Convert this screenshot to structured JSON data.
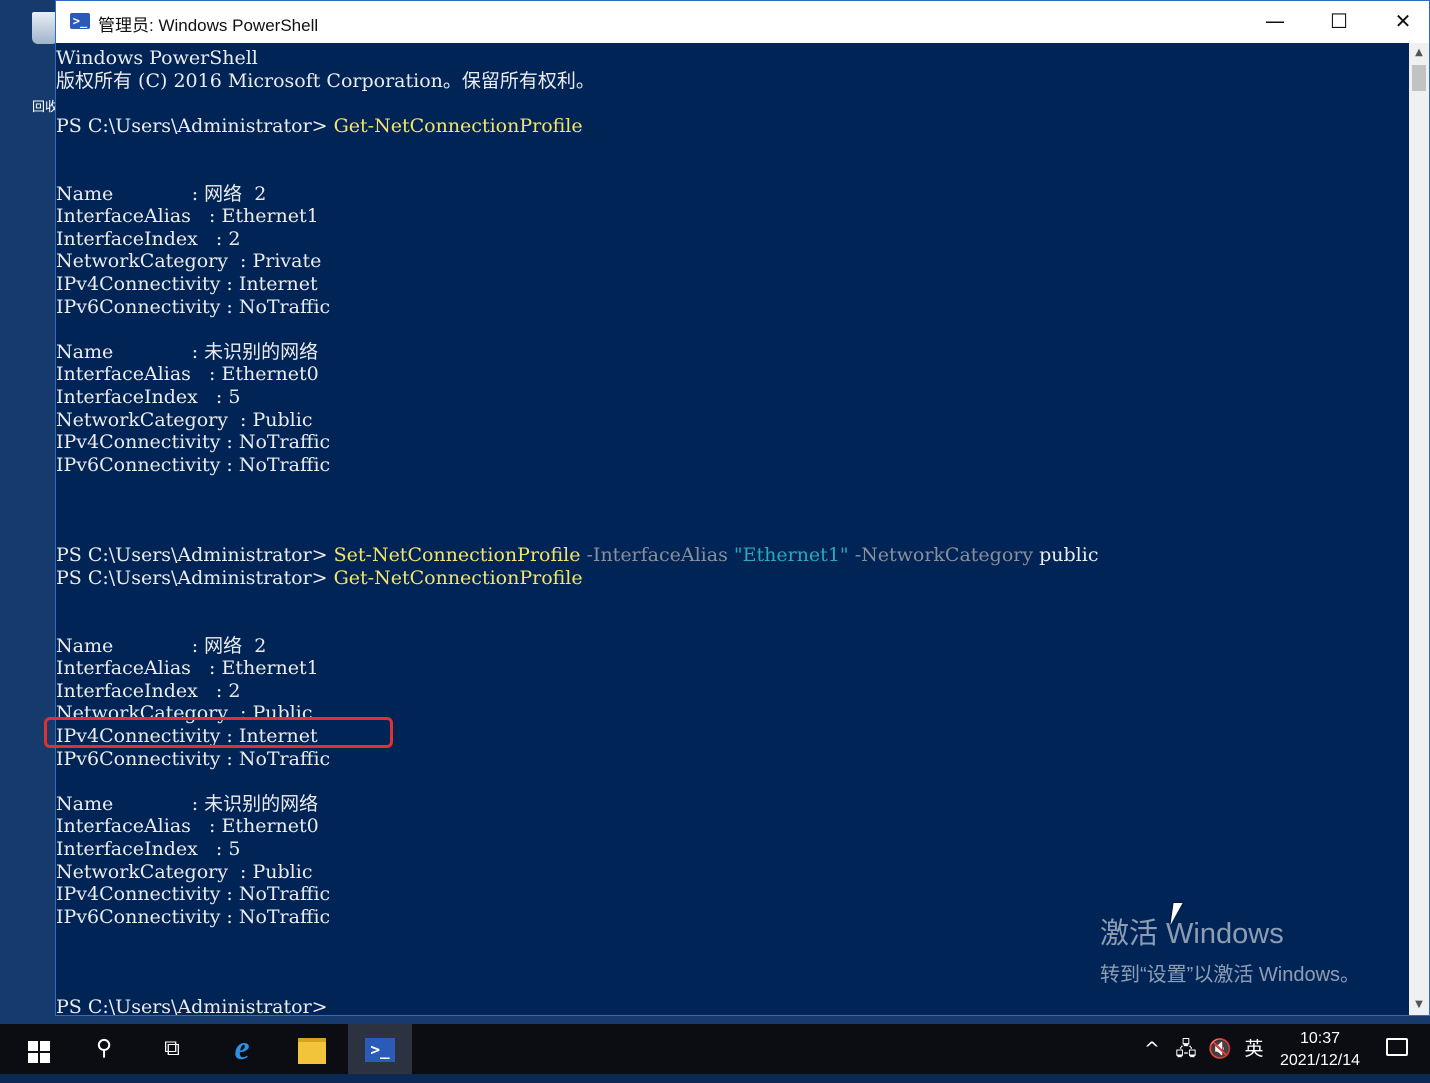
{
  "desktop": {
    "recycle_bin_label": "回收"
  },
  "window": {
    "title": "管理员: Windows PowerShell",
    "buttons": {
      "minimize": "—",
      "maximize": "☐",
      "close": "✕"
    }
  },
  "console": {
    "lines": [
      {
        "segs": [
          {
            "t": "Windows PowerShell",
            "c": "val"
          }
        ]
      },
      {
        "segs": [
          {
            "t": "版权所有 (C) 2016 Microsoft Corporation。保留所有权利。",
            "c": "val"
          }
        ]
      },
      {
        "segs": [
          {
            "t": "",
            "c": "val"
          }
        ]
      },
      {
        "segs": [
          {
            "t": "PS C:\\Users\\Administrator> ",
            "c": "val"
          },
          {
            "t": "Get-NetConnectionProfile",
            "c": "cmd"
          }
        ]
      },
      {
        "segs": [
          {
            "t": "",
            "c": "val"
          }
        ]
      },
      {
        "segs": [
          {
            "t": "",
            "c": "val"
          }
        ]
      },
      {
        "segs": [
          {
            "t": "Name             : 网络  2",
            "c": "val"
          }
        ]
      },
      {
        "segs": [
          {
            "t": "InterfaceAlias   : Ethernet1",
            "c": "val"
          }
        ]
      },
      {
        "segs": [
          {
            "t": "InterfaceIndex   : 2",
            "c": "val"
          }
        ]
      },
      {
        "segs": [
          {
            "t": "NetworkCategory  : Private",
            "c": "val"
          }
        ]
      },
      {
        "segs": [
          {
            "t": "IPv4Connectivity : Internet",
            "c": "val"
          }
        ]
      },
      {
        "segs": [
          {
            "t": "IPv6Connectivity : NoTraffic",
            "c": "val"
          }
        ]
      },
      {
        "segs": [
          {
            "t": "",
            "c": "val"
          }
        ]
      },
      {
        "segs": [
          {
            "t": "Name             : 未识别的网络",
            "c": "val"
          }
        ]
      },
      {
        "segs": [
          {
            "t": "InterfaceAlias   : Ethernet0",
            "c": "val"
          }
        ]
      },
      {
        "segs": [
          {
            "t": "InterfaceIndex   : 5",
            "c": "val"
          }
        ]
      },
      {
        "segs": [
          {
            "t": "NetworkCategory  : Public",
            "c": "val"
          }
        ]
      },
      {
        "segs": [
          {
            "t": "IPv4Connectivity : NoTraffic",
            "c": "val"
          }
        ]
      },
      {
        "segs": [
          {
            "t": "IPv6Connectivity : NoTraffic",
            "c": "val"
          }
        ]
      },
      {
        "segs": [
          {
            "t": "",
            "c": "val"
          }
        ]
      },
      {
        "segs": [
          {
            "t": "",
            "c": "val"
          }
        ]
      },
      {
        "segs": [
          {
            "t": "",
            "c": "val"
          }
        ]
      },
      {
        "segs": [
          {
            "t": "PS C:\\Users\\Administrator> ",
            "c": "val"
          },
          {
            "t": "Set-NetConnectionProfile ",
            "c": "cmd"
          },
          {
            "t": "-InterfaceAlias ",
            "c": "param"
          },
          {
            "t": "\"Ethernet1\" ",
            "c": "str"
          },
          {
            "t": "-NetworkCategory ",
            "c": "param"
          },
          {
            "t": "public",
            "c": "val"
          }
        ]
      },
      {
        "segs": [
          {
            "t": "PS C:\\Users\\Administrator> ",
            "c": "val"
          },
          {
            "t": "Get-NetConnectionProfile",
            "c": "cmd"
          }
        ]
      },
      {
        "segs": [
          {
            "t": "",
            "c": "val"
          }
        ]
      },
      {
        "segs": [
          {
            "t": "",
            "c": "val"
          }
        ]
      },
      {
        "segs": [
          {
            "t": "Name             : 网络  2",
            "c": "val"
          }
        ]
      },
      {
        "segs": [
          {
            "t": "InterfaceAlias   : Ethernet1",
            "c": "val"
          }
        ]
      },
      {
        "segs": [
          {
            "t": "InterfaceIndex   : 2",
            "c": "val"
          }
        ]
      },
      {
        "segs": [
          {
            "t": "NetworkCategory  : Public",
            "c": "val"
          }
        ]
      },
      {
        "segs": [
          {
            "t": "IPv4Connectivity : Internet",
            "c": "val"
          }
        ]
      },
      {
        "segs": [
          {
            "t": "IPv6Connectivity : NoTraffic",
            "c": "val"
          }
        ]
      },
      {
        "segs": [
          {
            "t": "",
            "c": "val"
          }
        ]
      },
      {
        "segs": [
          {
            "t": "Name             : 未识别的网络",
            "c": "val"
          }
        ]
      },
      {
        "segs": [
          {
            "t": "InterfaceAlias   : Ethernet0",
            "c": "val"
          }
        ]
      },
      {
        "segs": [
          {
            "t": "InterfaceIndex   : 5",
            "c": "val"
          }
        ]
      },
      {
        "segs": [
          {
            "t": "NetworkCategory  : Public",
            "c": "val"
          }
        ]
      },
      {
        "segs": [
          {
            "t": "IPv4Connectivity : NoTraffic",
            "c": "val"
          }
        ]
      },
      {
        "segs": [
          {
            "t": "IPv6Connectivity : NoTraffic",
            "c": "val"
          }
        ]
      },
      {
        "segs": [
          {
            "t": "",
            "c": "val"
          }
        ]
      },
      {
        "segs": [
          {
            "t": "",
            "c": "val"
          }
        ]
      },
      {
        "segs": [
          {
            "t": "",
            "c": "val"
          }
        ]
      },
      {
        "segs": [
          {
            "t": "PS C:\\Users\\Administrator>",
            "c": "val"
          }
        ]
      }
    ]
  },
  "watermark": {
    "title": "激活 Windows",
    "subtitle": "转到“设置”以激活 Windows。"
  },
  "taskbar": {
    "ime": "英",
    "time": "10:37",
    "date": "2021/12/14"
  },
  "colors": {
    "console_bg": "#012456",
    "command": "#f5e36a",
    "parameter": "#8a8f99",
    "string": "#2aa9b8",
    "highlight_box": "#e0302f"
  }
}
